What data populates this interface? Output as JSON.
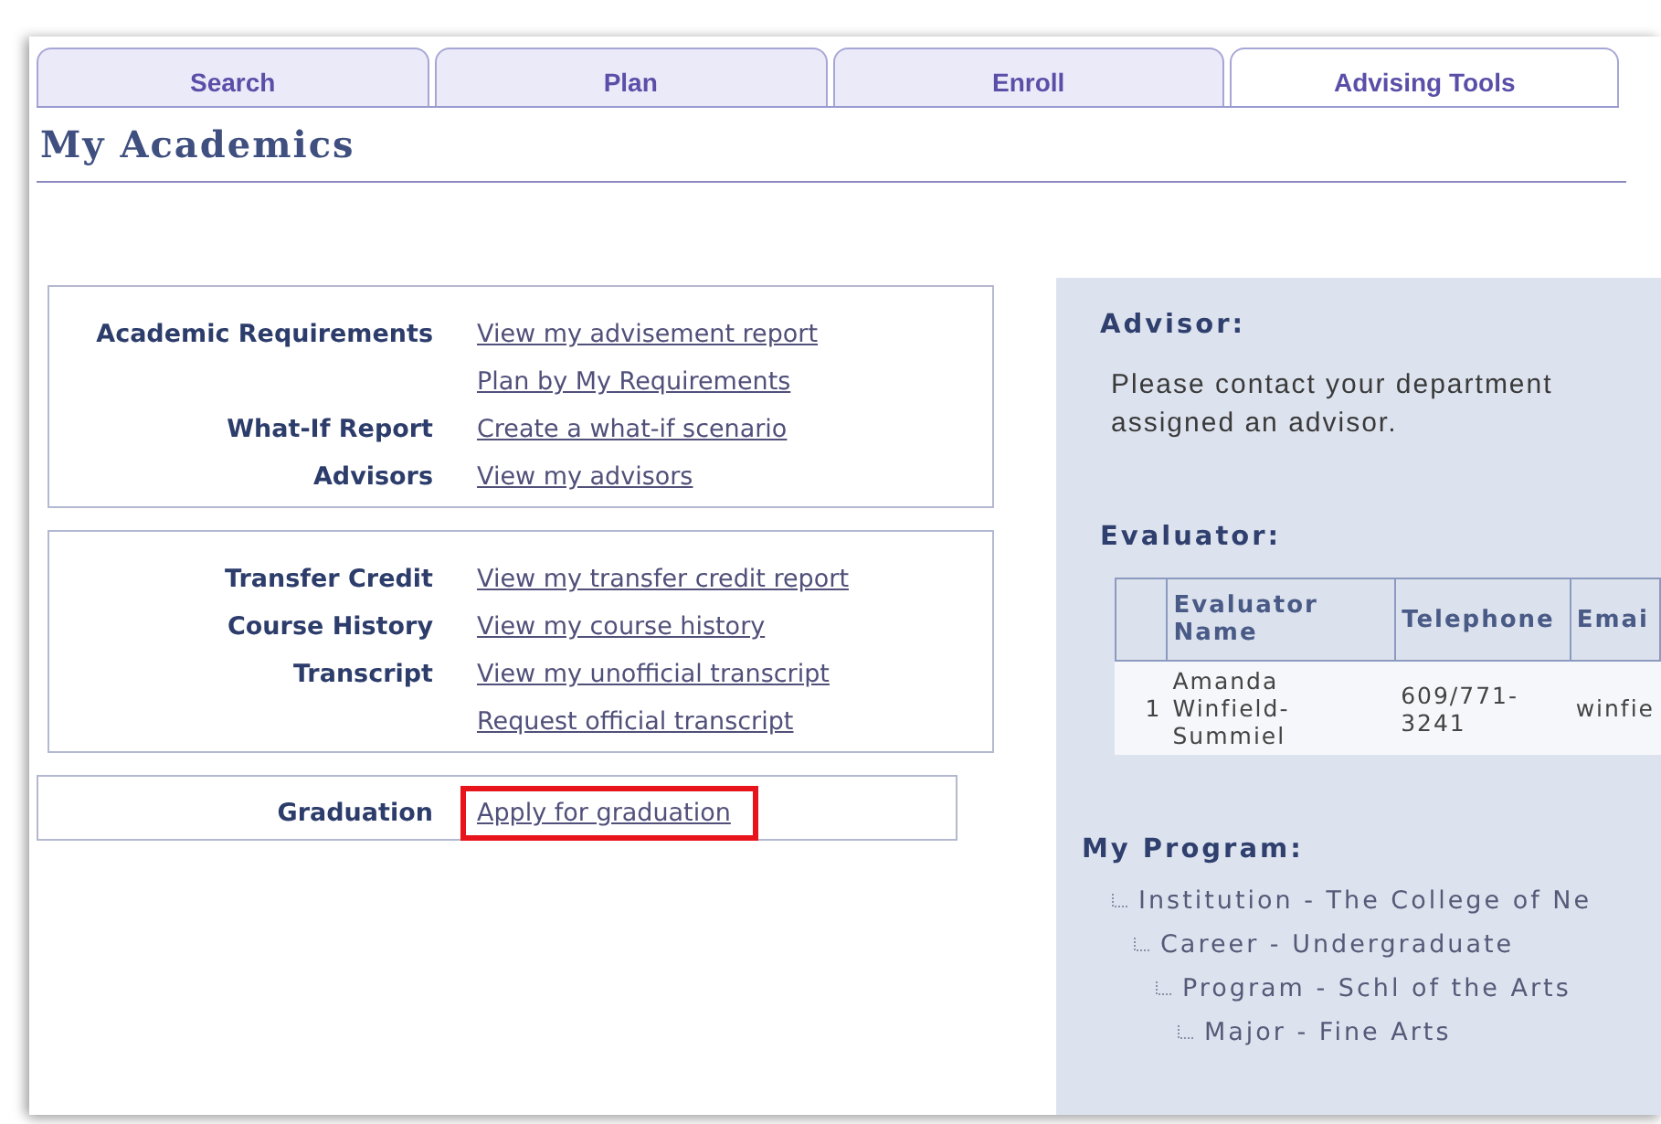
{
  "tabs": [
    {
      "label": "Search",
      "selected": false
    },
    {
      "label": "Plan",
      "selected": false
    },
    {
      "label": "Enroll",
      "selected": false
    },
    {
      "label": "Advising Tools",
      "selected": true
    }
  ],
  "page_title": "My Academics",
  "sections": [
    {
      "rows": [
        {
          "label": "Academic Requirements",
          "links": [
            {
              "text": "View my advisement report",
              "highlighted": false
            },
            {
              "text": "Plan by My Requirements",
              "highlighted": false
            }
          ]
        },
        {
          "label": "What-If Report",
          "links": [
            {
              "text": "Create a what-if scenario",
              "highlighted": false
            }
          ]
        },
        {
          "label": "Advisors",
          "links": [
            {
              "text": "View my advisors",
              "highlighted": false
            }
          ]
        }
      ]
    },
    {
      "rows": [
        {
          "label": "Transfer Credit",
          "links": [
            {
              "text": "View my transfer credit report",
              "highlighted": false
            }
          ]
        },
        {
          "label": "Course History",
          "links": [
            {
              "text": "View my course history",
              "highlighted": false
            }
          ]
        },
        {
          "label": "Transcript",
          "links": [
            {
              "text": "View my unofficial transcript",
              "highlighted": false
            },
            {
              "text": "Request official transcript",
              "highlighted": false
            }
          ]
        }
      ]
    },
    {
      "rows": [
        {
          "label": "Graduation",
          "links": [
            {
              "text": "Apply for graduation",
              "highlighted": true
            }
          ]
        }
      ]
    }
  ],
  "advisor": {
    "heading": "Advisor:",
    "message_lines": [
      "Please contact your department",
      "assigned an advisor."
    ]
  },
  "evaluator": {
    "heading": "Evaluator:",
    "columns": [
      "Evaluator Name",
      "Telephone",
      "Emai"
    ],
    "rows": [
      {
        "number": "1",
        "cells": [
          "Amanda Winfield-Summiel",
          "609/771-3241",
          "winfie"
        ]
      }
    ]
  },
  "program": {
    "heading": "My Program:",
    "tree": [
      {
        "text": "Institution - The College of Ne",
        "children": [
          {
            "text": "Career - Undergraduate",
            "children": [
              {
                "text": "Program - Schl of the Arts",
                "children": [
                  {
                    "text": "Major - Fine Arts"
                  }
                ]
              }
            ]
          }
        ]
      }
    ]
  }
}
